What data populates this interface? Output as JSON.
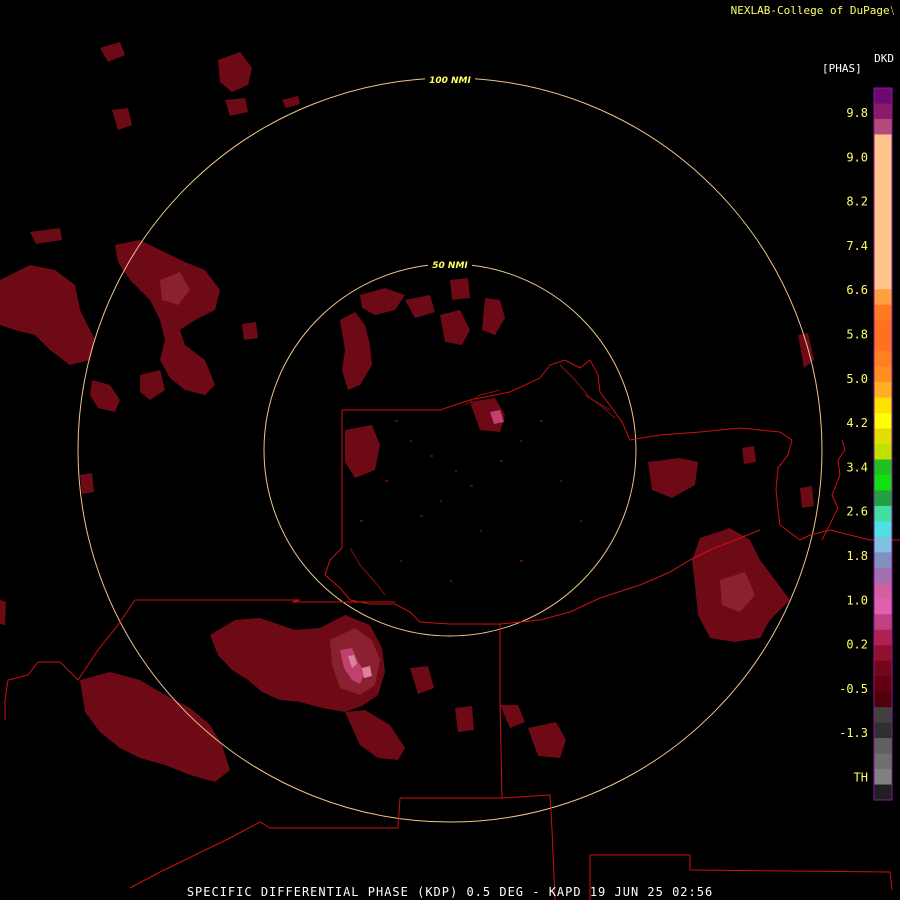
{
  "header": {
    "credit": "NEXLAB-College of DuPage",
    "credit_icon": "cod-logo-icon"
  },
  "footer": {
    "product_title": "SPECIFIC DIFFERENTIAL PHASE (KDP) 0.5 DEG - KAPD 19 JUN 25 02:56"
  },
  "map": {
    "range_rings": [
      {
        "label": "50 NMI"
      },
      {
        "label": "100 NMI"
      }
    ],
    "ring_color": "#f0c48a",
    "boundary_color": "#cc1111",
    "echo_color": "#6e0a16"
  },
  "legend": {
    "unit_top": "DKD",
    "unit_bottom": "[PHAS]",
    "labels": [
      "9.8",
      "9.0",
      "8.2",
      "7.4",
      "6.6",
      "5.8",
      "5.0",
      "4.2",
      "3.4",
      "2.6",
      "1.8",
      "1.0",
      "0.2",
      "-0.5",
      "-1.3",
      "TH"
    ],
    "colors": [
      "#6a0a6e",
      "#8a1a6a",
      "#b44a7a",
      "#ffc48a",
      "#ffc48a",
      "#ffc48a",
      "#ffc48a",
      "#ffc48a",
      "#ffc48a",
      "#ffc48a",
      "#ffc48a",
      "#ffc48a",
      "#ffc48a",
      "#ffa040",
      "#ff7a20",
      "#ff7020",
      "#ff7020",
      "#ff8020",
      "#ff9020",
      "#ffb020",
      "#ffe000",
      "#ffff00",
      "#e0e000",
      "#c0e000",
      "#20c020",
      "#10e010",
      "#20a040",
      "#40e0a0",
      "#50e0e0",
      "#80c0e0",
      "#8090c0",
      "#a070b0",
      "#d060a0",
      "#e060b0",
      "#c04080",
      "#b02050",
      "#901030",
      "#700818",
      "#600010",
      "#500008",
      "#404040",
      "#303030",
      "#606060",
      "#707070",
      "#808080",
      "#202020"
    ],
    "border_color": "#8a1aa0"
  }
}
